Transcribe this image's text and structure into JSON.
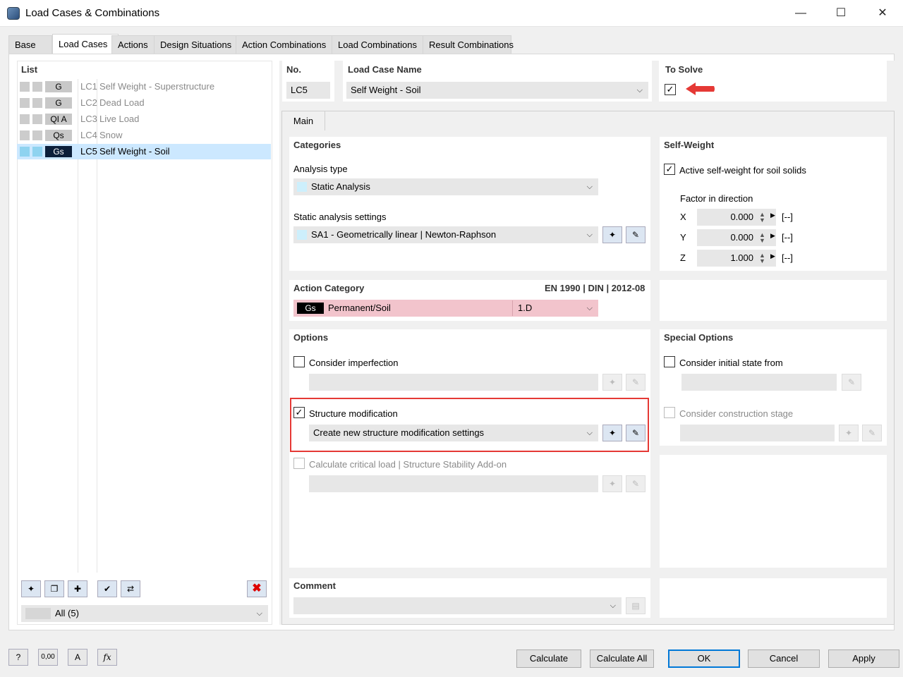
{
  "window": {
    "title": "Load Cases & Combinations",
    "min": "—",
    "max": "☐",
    "close": "✕"
  },
  "tabs": [
    "Base",
    "Load Cases",
    "Actions",
    "Design Situations",
    "Action Combinations",
    "Load Combinations",
    "Result Combinations"
  ],
  "list": {
    "header": "List",
    "items": [
      {
        "code": "G",
        "id": "LC1",
        "name": "Self Weight - Superstructure"
      },
      {
        "code": "G",
        "id": "LC2",
        "name": "Dead Load"
      },
      {
        "code": "QI A",
        "id": "LC3",
        "name": "Live Load"
      },
      {
        "code": "Qs",
        "id": "LC4",
        "name": "Snow"
      },
      {
        "code": "Gs",
        "id": "LC5",
        "name": "Self Weight - Soil"
      }
    ],
    "filter": "All (5)",
    "delete_icon": "✖"
  },
  "no": {
    "label": "No.",
    "value": "LC5"
  },
  "load_case_name": {
    "label": "Load Case Name",
    "value": "Self Weight - Soil"
  },
  "to_solve": {
    "label": "To Solve",
    "checked": "✓"
  },
  "main_tab": "Main",
  "categories": {
    "label": "Categories",
    "analysis_type_label": "Analysis type",
    "analysis_type": "Static Analysis",
    "static_settings_label": "Static analysis settings",
    "static_settings": "SA1 - Geometrically linear | Newton-Raphson"
  },
  "self_weight": {
    "label": "Self-Weight",
    "active_label": "Active self-weight for soil solids",
    "factor_label": "Factor in direction",
    "x_label": "X",
    "x": "0.000",
    "y_label": "Y",
    "y": "0.000",
    "z_label": "Z",
    "z": "1.000",
    "unit": "[--]"
  },
  "action_category": {
    "label": "Action Category",
    "norm": "EN 1990 | DIN | 2012-08",
    "code": "Gs",
    "name": "Permanent/Soil",
    "id": "1.D"
  },
  "options": {
    "label": "Options",
    "imperfection": "Consider imperfection",
    "structure_mod": "Structure modification",
    "structure_mod_value": "Create new structure modification settings",
    "critical_load": "Calculate critical load | Structure Stability Add-on"
  },
  "special_options": {
    "label": "Special Options",
    "initial_state": "Consider initial state from",
    "construction_stage": "Consider construction stage"
  },
  "comment": {
    "label": "Comment"
  },
  "buttons": {
    "calculate": "Calculate",
    "calculate_all": "Calculate All",
    "ok": "OK",
    "cancel": "Cancel",
    "apply": "Apply"
  },
  "status_icons": {
    "value_label": "0,00",
    "fx": "fx"
  },
  "colors": {
    "accent": "#0078d7",
    "highlight_box": "#e53935",
    "selected_row": "#cce8ff",
    "action_row": "#f2c4cc"
  }
}
